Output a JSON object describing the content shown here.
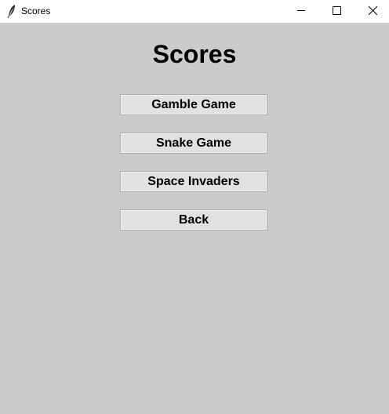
{
  "window": {
    "title": "Scores",
    "icon": "feather-icon",
    "controls": [
      "minimize-icon",
      "maximize-icon",
      "close-icon"
    ]
  },
  "main": {
    "heading": "Scores",
    "buttons": [
      {
        "label": "Gamble Game"
      },
      {
        "label": "Snake Game"
      },
      {
        "label": "Space Invaders"
      },
      {
        "label": "Back"
      }
    ]
  },
  "colors": {
    "background": "#cbcbcb",
    "button_face": "#e1e1e1",
    "button_border": "#adadad",
    "titlebar": "#ffffff"
  }
}
